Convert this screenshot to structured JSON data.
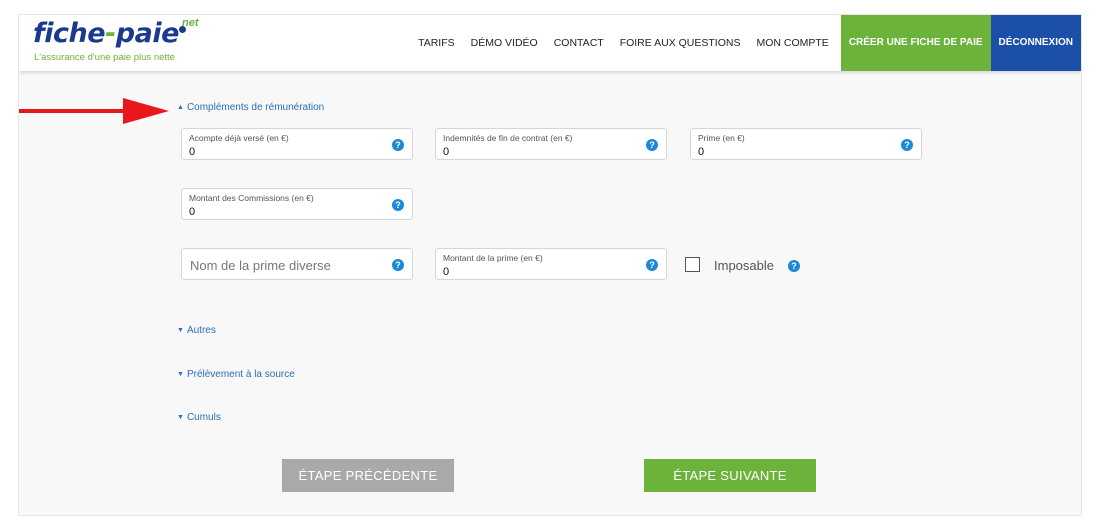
{
  "header": {
    "logo_text_a": "fiche",
    "logo_text_dash": "-",
    "logo_text_b": "paie",
    "logo_net": "net",
    "logo_tagline": "L'assurance d'une paie plus nette",
    "nav": [
      "TARIFS",
      "DÉMO VIDÉO",
      "CONTACT",
      "FOIRE AUX QUESTIONS",
      "MON COMPTE"
    ],
    "create_label": "CRÉER UNE FICHE DE PAIE",
    "logout_label": "DÉCONNEXION"
  },
  "sections": {
    "complements": "Compléments de rémunération",
    "autres": "Autres",
    "prelevement": "Prélèvement à la source",
    "cumuls": "Cumuls"
  },
  "fields": {
    "acompte": {
      "label": "Acompte déjà versé (en €)",
      "value": "0"
    },
    "indemnites": {
      "label": "Indemnités de fin de contrat (en €)",
      "value": "0"
    },
    "prime": {
      "label": "Prime (en €)",
      "value": "0"
    },
    "commissions": {
      "label": "Montant des Commissions (en €)",
      "value": "0"
    },
    "nom_prime": {
      "placeholder": "Nom de la prime diverse"
    },
    "montant_prime": {
      "label": "Montant de la prime (en €)",
      "value": "0"
    }
  },
  "imposable_label": "Imposable",
  "help_glyph": "?",
  "buttons": {
    "prev": "ÉTAPE PRÉCÉDENTE",
    "next": "ÉTAPE SUIVANTE"
  },
  "colors": {
    "brand_blue": "#1b3a8f",
    "brand_green": "#6bb33a",
    "link_blue": "#2b6fb3",
    "logout_blue": "#1b4fa8",
    "annotation_red": "#e8171b"
  }
}
